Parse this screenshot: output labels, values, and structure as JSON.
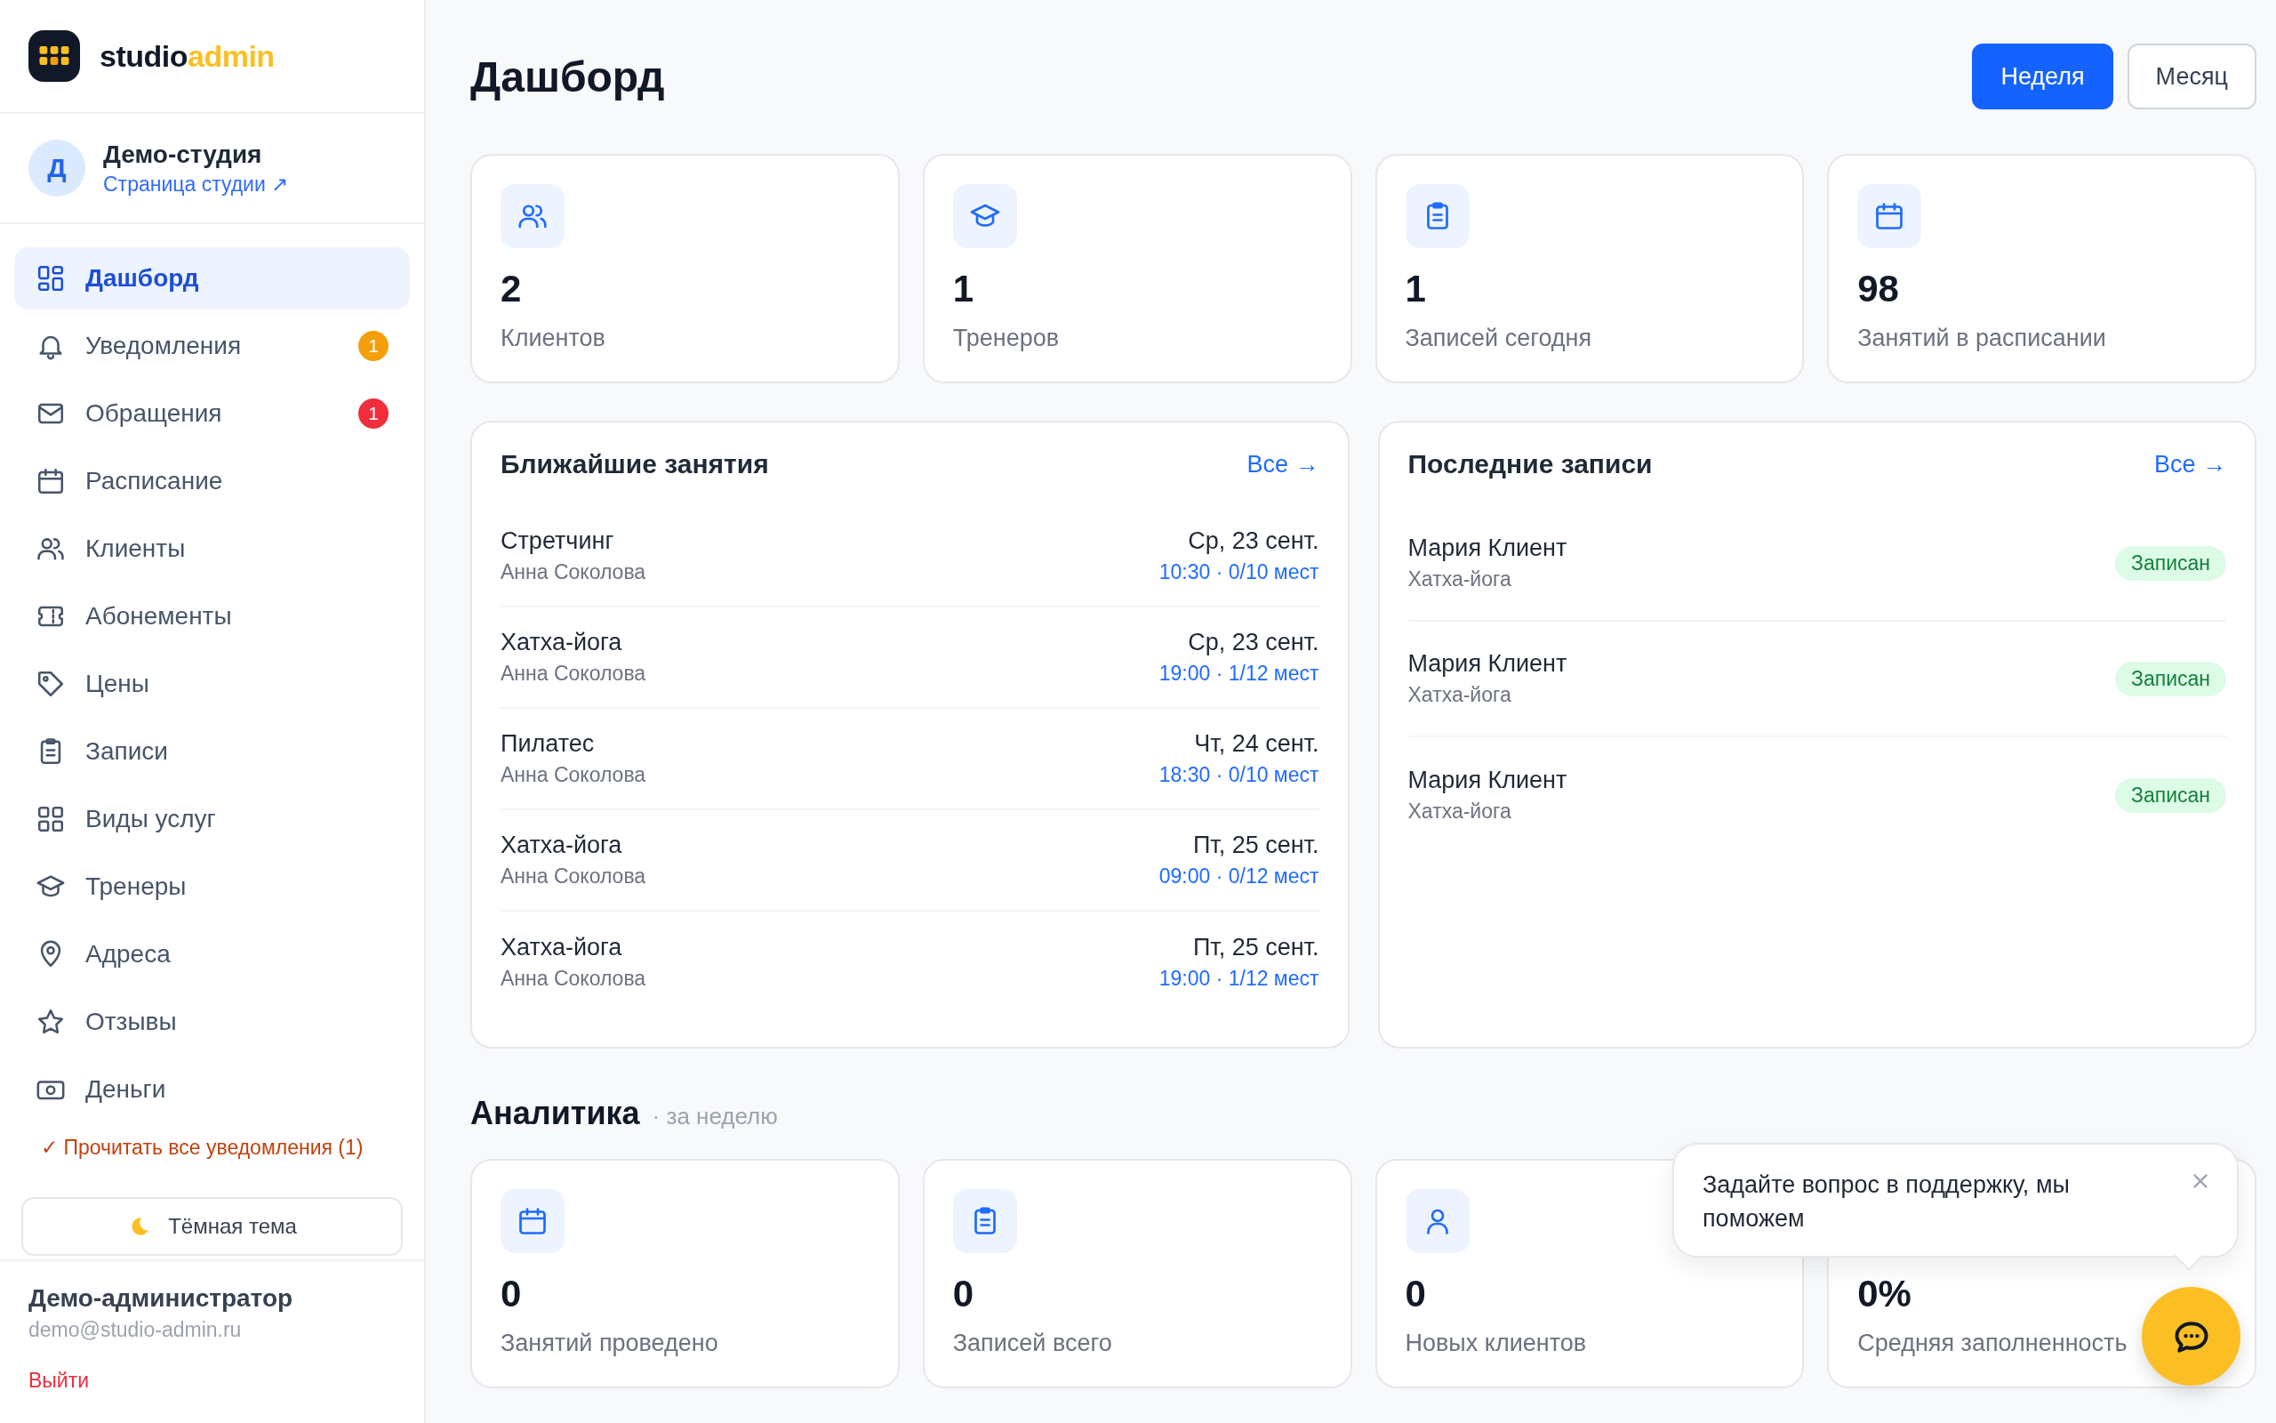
{
  "logo": {
    "text": "studio",
    "accent": "admin"
  },
  "studio": {
    "avatar": "Д",
    "name": "Демо-студия",
    "link": "Страница студии ↗"
  },
  "nav": [
    {
      "label": "Дашборд",
      "kind": "dashboard",
      "selected": true
    },
    {
      "label": "Уведомления",
      "kind": "bell",
      "selected": false,
      "badge": "1",
      "color": "#f59e0b"
    },
    {
      "label": "Обращения",
      "kind": "mail",
      "selected": false,
      "badge": "1",
      "color": "#ef2e3c"
    },
    {
      "label": "Расписание",
      "kind": "calendar",
      "selected": false
    },
    {
      "label": "Клиенты",
      "kind": "users",
      "selected": false
    },
    {
      "label": "Абонементы",
      "kind": "ticket",
      "selected": false
    },
    {
      "label": "Цены",
      "kind": "tag",
      "selected": false
    },
    {
      "label": "Записи",
      "kind": "clipboard",
      "selected": false
    },
    {
      "label": "Виды услуг",
      "kind": "grid",
      "selected": false
    },
    {
      "label": "Тренеры",
      "kind": "cap",
      "selected": false
    },
    {
      "label": "Адреса",
      "kind": "pin",
      "selected": false
    },
    {
      "label": "Отзывы",
      "kind": "star",
      "selected": false
    },
    {
      "label": "Деньги",
      "kind": "money",
      "selected": false
    }
  ],
  "mark_all_read": "✓ Прочитать все уведомления (1)",
  "theme_button": "Тёмная тема",
  "user": {
    "name": "Демо-администратор",
    "email": "demo@studio-admin.ru",
    "logout": "Выйти"
  },
  "page_title": "Дашборд",
  "period_buttons": [
    {
      "label": "Неделя",
      "selected": true
    },
    {
      "label": "Месяц",
      "selected": false
    }
  ],
  "stats": [
    {
      "kind": "users",
      "value": "2",
      "label": "Клиентов"
    },
    {
      "kind": "cap",
      "value": "1",
      "label": "Тренеров"
    },
    {
      "kind": "clipboard",
      "value": "1",
      "label": "Записей сегодня"
    },
    {
      "kind": "calendar",
      "value": "98",
      "label": "Занятий в расписании"
    }
  ],
  "upcoming": {
    "title": "Ближайшие занятия",
    "link": "Все →",
    "rows": [
      {
        "name": "Стретчинг",
        "trainer": "Анна Соколова",
        "date": "Ср, 23 сент.",
        "details": "10:30 · 0/10 мест"
      },
      {
        "name": "Хатха-йога",
        "trainer": "Анна Соколова",
        "date": "Ср, 23 сент.",
        "details": "19:00 · 1/12 мест"
      },
      {
        "name": "Пилатес",
        "trainer": "Анна Соколова",
        "date": "Чт, 24 сент.",
        "details": "18:30 · 0/10 мест"
      },
      {
        "name": "Хатха-йога",
        "trainer": "Анна Соколова",
        "date": "Пт, 25 сент.",
        "details": "09:00 · 0/12 мест"
      },
      {
        "name": "Хатха-йога",
        "trainer": "Анна Соколова",
        "date": "Пт, 25 сент.",
        "details": "19:00 · 1/12 мест"
      }
    ]
  },
  "recent": {
    "title": "Последние записи",
    "link": "Все →",
    "rows": [
      {
        "name": "Мария Клиент",
        "service": "Хатха-йога",
        "status": "Записан"
      },
      {
        "name": "Мария Клиент",
        "service": "Хатха-йога",
        "status": "Записан"
      },
      {
        "name": "Мария Клиент",
        "service": "Хатха-йога",
        "status": "Записан"
      }
    ]
  },
  "analytics": {
    "title": "Аналитика",
    "subtitle": "· за неделю",
    "stats": [
      {
        "kind": "calendar",
        "value": "0",
        "label": "Занятий проведено"
      },
      {
        "kind": "clipboard",
        "value": "0",
        "label": "Записей всего"
      },
      {
        "kind": "user",
        "value": "0",
        "label": "Новых клиентов"
      },
      {
        "value": "0%",
        "label": "Средняя заполненность"
      }
    ]
  },
  "support": {
    "message": "Задайте вопрос в поддержку, мы поможем"
  }
}
